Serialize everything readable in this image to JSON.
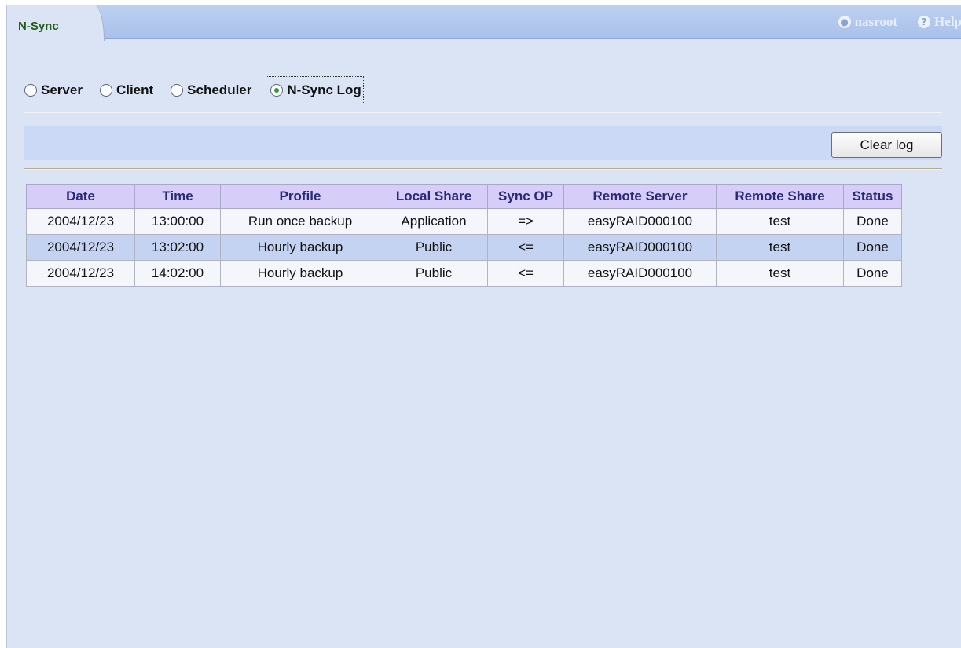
{
  "tab": {
    "label": "N-Sync"
  },
  "header": {
    "user_label": "nasroot",
    "help_label": "Help",
    "user_icon": "user-icon",
    "help_icon": "help-icon"
  },
  "modes": [
    {
      "label": "Server",
      "selected": false
    },
    {
      "label": "Client",
      "selected": false
    },
    {
      "label": "Scheduler",
      "selected": false
    },
    {
      "label": "N-Sync Log",
      "selected": true
    }
  ],
  "toolbar": {
    "clear_label": "Clear log"
  },
  "log": {
    "columns": [
      "Date",
      "Time",
      "Profile",
      "Local Share",
      "Sync OP",
      "Remote Server",
      "Remote Share",
      "Status"
    ],
    "rows": [
      [
        "2004/12/23",
        "13:00:00",
        "Run once backup",
        "Application",
        "=>",
        "easyRAID000100",
        "test",
        "Done"
      ],
      [
        "2004/12/23",
        "13:02:00",
        "Hourly backup",
        "Public",
        "<=",
        "easyRAID000100",
        "test",
        "Done"
      ],
      [
        "2004/12/23",
        "14:02:00",
        "Hourly backup",
        "Public",
        "<=",
        "easyRAID000100",
        "test",
        "Done"
      ]
    ]
  },
  "colors": {
    "panel_bg": "#dbe4f5",
    "header_bar": "#a9c1ea",
    "tab_text": "#1f5e16",
    "table_header_bg": "#d6cef8",
    "table_header_text": "#29297a",
    "row_alt_bg": "#c5d3f2",
    "radio_selected": "#2f9a2f"
  }
}
